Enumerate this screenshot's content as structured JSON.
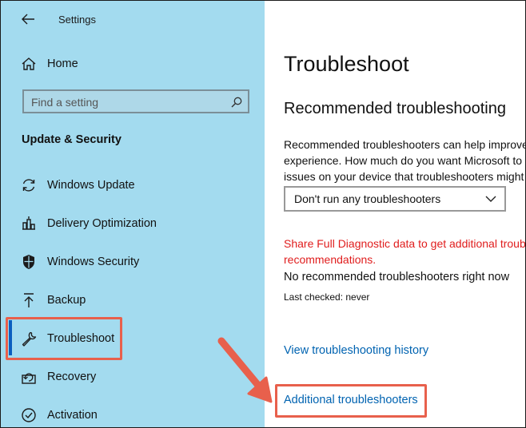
{
  "window": {
    "title": "Settings"
  },
  "sidebar": {
    "home_label": "Home",
    "search": {
      "placeholder": "Find a setting",
      "value": ""
    },
    "section_heading": "Update & Security",
    "items": [
      {
        "label": "Windows Update",
        "icon": "sync-icon"
      },
      {
        "label": "Delivery Optimization",
        "icon": "delivery-optimization-icon"
      },
      {
        "label": "Windows Security",
        "icon": "shield-icon"
      },
      {
        "label": "Backup",
        "icon": "upload-arrow-icon"
      },
      {
        "label": "Troubleshoot",
        "icon": "wrench-icon",
        "selected": true
      },
      {
        "label": "Recovery",
        "icon": "recovery-icon"
      },
      {
        "label": "Activation",
        "icon": "check-circle-icon"
      }
    ]
  },
  "main": {
    "page_title": "Troubleshoot",
    "recommended_heading": "Recommended troubleshooting",
    "description_lines": [
      "Recommended troubleshooters can help improve",
      "experience. How much do you want Microsoft to",
      "issues on your device that troubleshooters might"
    ],
    "dropdown": {
      "selected": "Don't run any troubleshooters"
    },
    "warning_lines": [
      "Share Full Diagnostic data to get additional troub",
      "recommendations."
    ],
    "status": "No recommended troubleshooters right now",
    "last_checked": "Last checked: never",
    "history_link": "View troubleshooting history",
    "additional_link": "Additional troubleshooters"
  },
  "colors": {
    "sidebar_bg": "#a3dbef",
    "accent": "#0b5fbf",
    "link": "#0063b1",
    "warning": "#e01d1d",
    "highlight": "#e8604c"
  }
}
